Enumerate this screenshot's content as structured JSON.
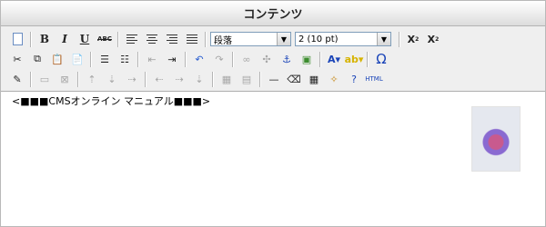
{
  "title": "コンテンツ",
  "toolbar": {
    "format_select": "段落",
    "size_select": "2 (10 pt)",
    "html_label": "HTML"
  },
  "editor": {
    "content": "<■■■CMSオンライン マニュアル■■■>"
  },
  "colors": {
    "title_bg": "#ececec",
    "toolbar_bg": "#efefef",
    "border": "#b9b9b9",
    "font_color": "#1a44b8",
    "highlight": "#f0d020"
  }
}
